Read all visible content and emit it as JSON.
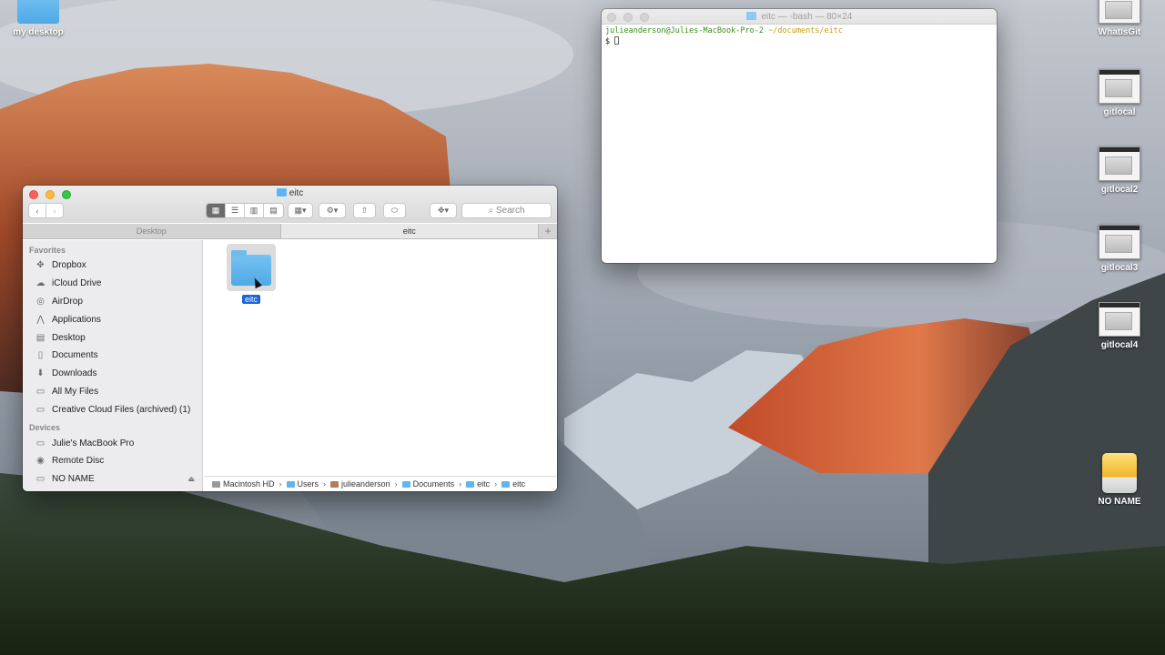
{
  "desktop": {
    "icons_left": [
      {
        "label": "my desktop"
      }
    ],
    "icons_right": [
      {
        "label": "WhatIsGit"
      },
      {
        "label": "gitlocal"
      },
      {
        "label": "gitlocal2"
      },
      {
        "label": "gitlocal3"
      },
      {
        "label": "gitlocal4"
      },
      {
        "label": "NO NAME"
      }
    ]
  },
  "terminal": {
    "title": "eitc — -bash — 80×24",
    "prompt_user": "julieanderson@Julies-MacBook-Pro-2",
    "prompt_path": "~/documents/eitc",
    "prompt_symbol": "$"
  },
  "finder": {
    "title": "eitc",
    "search_placeholder": "Search",
    "tabs": [
      {
        "label": "Desktop"
      },
      {
        "label": "eitc"
      }
    ],
    "tab_add": "+",
    "sidebar": {
      "favorites_heading": "Favorites",
      "favorites": [
        {
          "label": "Dropbox",
          "icon": "dropbox-icon"
        },
        {
          "label": "iCloud Drive",
          "icon": "cloud-icon"
        },
        {
          "label": "AirDrop",
          "icon": "airdrop-icon"
        },
        {
          "label": "Applications",
          "icon": "applications-icon"
        },
        {
          "label": "Desktop",
          "icon": "desktop-icon"
        },
        {
          "label": "Documents",
          "icon": "document-icon"
        },
        {
          "label": "Downloads",
          "icon": "download-icon"
        },
        {
          "label": "All My Files",
          "icon": "all-files-icon"
        },
        {
          "label": "Creative Cloud Files (archived) (1)",
          "icon": "folder-icon"
        }
      ],
      "devices_heading": "Devices",
      "devices": [
        {
          "label": "Julie's MacBook Pro",
          "icon": "laptop-icon"
        },
        {
          "label": "Remote Disc",
          "icon": "disc-icon"
        },
        {
          "label": "NO NAME",
          "icon": "drive-icon"
        }
      ]
    },
    "items": [
      {
        "label": "eitc",
        "selected": true
      }
    ],
    "path": [
      "Macintosh HD",
      "Users",
      "julieanderson",
      "Documents",
      "eitc",
      "eitc"
    ]
  }
}
